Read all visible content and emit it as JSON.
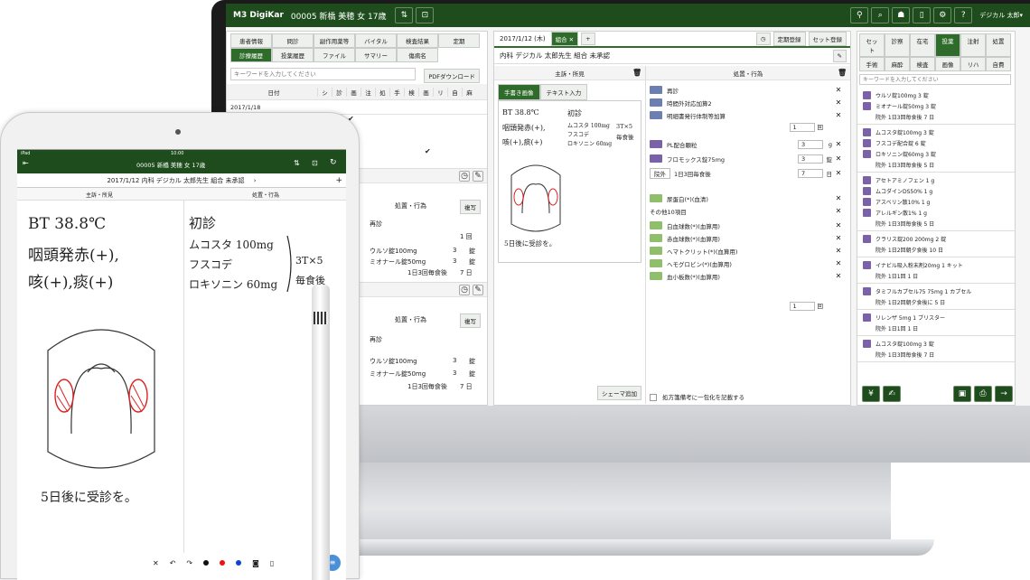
{
  "monitor": {
    "header": {
      "logo": "M3 DigiKar",
      "patient": "00005 新橋 美穂 女 17歳",
      "user": "デジカル 太郎▾"
    },
    "left": {
      "tabs_row1": [
        "患者情報",
        "問診",
        "副作用薬等",
        "バイタル",
        "検査結果",
        "定期"
      ],
      "tabs_row2": [
        "診療履歴",
        "投薬履歴",
        "ファイル",
        "サマリー",
        "傷病名"
      ],
      "search_placeholder": "キーワードを入力してください",
      "pdf_btn": "PDFダウンロード",
      "date_header": "日付",
      "cols": [
        "シ",
        "診",
        "画",
        "注",
        "処",
        "手",
        "検",
        "画",
        "リ",
        "自",
        "麻"
      ],
      "date1": "2017/1/18",
      "sec_title": "処置・行為",
      "copy": "複写",
      "rows": [
        "再診",
        "ウルソ錠100mg",
        "ミオナール錠50mg",
        "1日3回毎食後"
      ],
      "qtys": [
        "3",
        "3"
      ],
      "units": [
        "錠",
        "錠"
      ],
      "days": "7 日"
    },
    "center": {
      "date": "2017/1/12 (木)",
      "tab": "組合",
      "std_btn": "定期登録",
      "set_btn": "セット登録",
      "title": "内科 デジカル 太郎先生 組合 未承認",
      "sub_left": "主訴・所見",
      "sub_right": "処置・行為",
      "hw_tab": "手書き画像",
      "text_tab": "テキスト入力",
      "schema_btn": "シェーマ追加",
      "note": "処方箋備考に一包化を記載する",
      "hw_notes": [
        "BT 38.8℃",
        "咽頭発赤(+),",
        "咳(+),痰(+)",
        "初診",
        "ムコスタ 100mg",
        "フスコデ",
        "ロキソニン 60mg",
        "3T×5",
        "毎食後",
        "5日後に受診を。"
      ],
      "orders": [
        {
          "label": "再診",
          "tag": "b"
        },
        {
          "label": "時間外対応加算2",
          "tag": "b"
        },
        {
          "label": "明細書発行体制等加算",
          "tag": "b"
        },
        {
          "label": "PL配合顆粒",
          "tag": "p",
          "qty": "3",
          "unit": "g"
        },
        {
          "label": "フロモックス錠75mg",
          "tag": "p",
          "qty": "3",
          "unit": "錠"
        },
        {
          "label": "1日3回毎食後",
          "tag": "",
          "qty": "7",
          "unit": "日"
        },
        {
          "label": "尿蛋白(*)(血清)",
          "tag": "g"
        },
        {
          "label": "その他10項目",
          "tag": ""
        },
        {
          "label": "白血球数(*)(血算用)",
          "tag": "g"
        },
        {
          "label": "赤血球数(*)(血算用)",
          "tag": "g"
        },
        {
          "label": "ヘマトクリット(*)(血算用)",
          "tag": "g"
        },
        {
          "label": "ヘモグロビン(*)(血算用)",
          "tag": "g"
        },
        {
          "label": "血小板数(*)(血算用)",
          "tag": "g"
        }
      ],
      "qty1": "1",
      "qty_last": "1",
      "unit_kai": "回",
      "route": "院外",
      "route_opt": "1日3回毎食後"
    },
    "right": {
      "tabs_row1": [
        "セット",
        "診察",
        "在宅",
        "投薬",
        "注射",
        "処置"
      ],
      "tabs_row2": [
        "手術",
        "麻酔",
        "検査",
        "画像",
        "リハ",
        "自費"
      ],
      "search_placeholder": "キーワードを入力してください",
      "groups": [
        [
          "ウルソ錠100mg 3 錠",
          "ミオナール錠50mg 3 錠",
          "院外 1日3回毎食後 7 日"
        ],
        [
          "ムコスタ錠100mg 3 錠",
          "フスコデ配合錠 6 錠",
          "ロキソニン錠60mg 3 錠",
          "院外 1日3回毎食後 5 日"
        ],
        [
          "アセトアミノフェン 1 g",
          "ムコダインDS50% 1 g",
          "アスベリン散10% 1 g",
          "アレルギン散1% 1 g",
          "院外 1日3回毎食後 5 日"
        ],
        [
          "クラリス錠200 200mg 2 錠",
          "院外 1日2回朝夕食後 10 日"
        ],
        [
          "イナビル吸入粉末剤20mg 1 キット",
          "院外 1日1回 1 日"
        ],
        [
          "タミフルカプセル75 75mg 1 カプセル",
          "院外 1日2回朝夕食後に 5 日"
        ],
        [
          "リレンザ 5mg 1 ブリスター",
          "院外 1日1回 1 日"
        ],
        [
          "ムコスタ錠100mg 3 錠",
          "院外 1日3回毎食後 7 日"
        ]
      ]
    }
  },
  "ipad": {
    "status_left": "iPad",
    "status_time": "10:00",
    "patient": "00005 新橋 美穂 女 17歳",
    "title": "2017/1/12 内科 デジカル 太郎先生 組合 未承認",
    "sub_left": "主訴・所見",
    "sub_right": "処置・行為",
    "hw_left": [
      "BT 38.8℃",
      "咽頭発赤(+),",
      "咳(+),痰(+)",
      "5日後に受診を。"
    ],
    "hw_right": [
      "初診",
      "ムコスタ 100mg",
      "フスコデ",
      "ロキソニン 60mg",
      "3T×5",
      "毎食後"
    ]
  }
}
